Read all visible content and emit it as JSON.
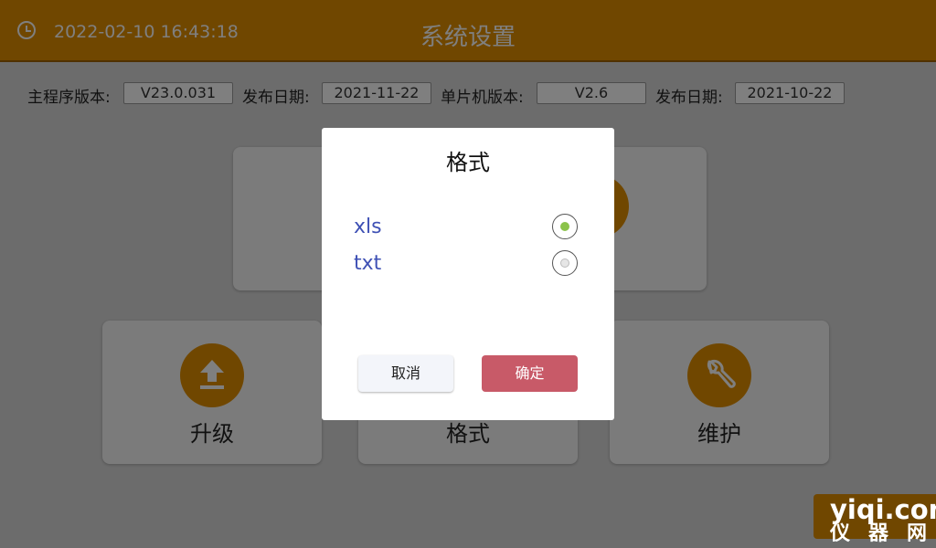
{
  "header": {
    "datetime": "2022-02-10 16:43:18",
    "title": "系统设置",
    "clock_icon": "clock-icon"
  },
  "info": {
    "main_version_label": "主程序版本:",
    "main_version": "V23.0.031",
    "main_date_label": "发布日期:",
    "main_date": "2021-11-22",
    "mcu_version_label": "单片机版本:",
    "mcu_version": "V2.6",
    "mcu_date_label": "发布日期:",
    "mcu_date": "2021-10-22"
  },
  "tiles": {
    "upgrade_label": "升级",
    "format_label": "格式",
    "maintain_label": "维护"
  },
  "dialog": {
    "title": "格式",
    "options": [
      {
        "label": "xls",
        "selected": true
      },
      {
        "label": "txt",
        "selected": false
      }
    ],
    "cancel_label": "取消",
    "ok_label": "确定"
  },
  "watermark": {
    "line1": "yiqi.com",
    "line2": "仪器网"
  },
  "colors": {
    "accent": "#e08e00",
    "ok_button": "#c85a68",
    "option_text": "#3f51b5",
    "radio_selected": "#8bc34a"
  }
}
